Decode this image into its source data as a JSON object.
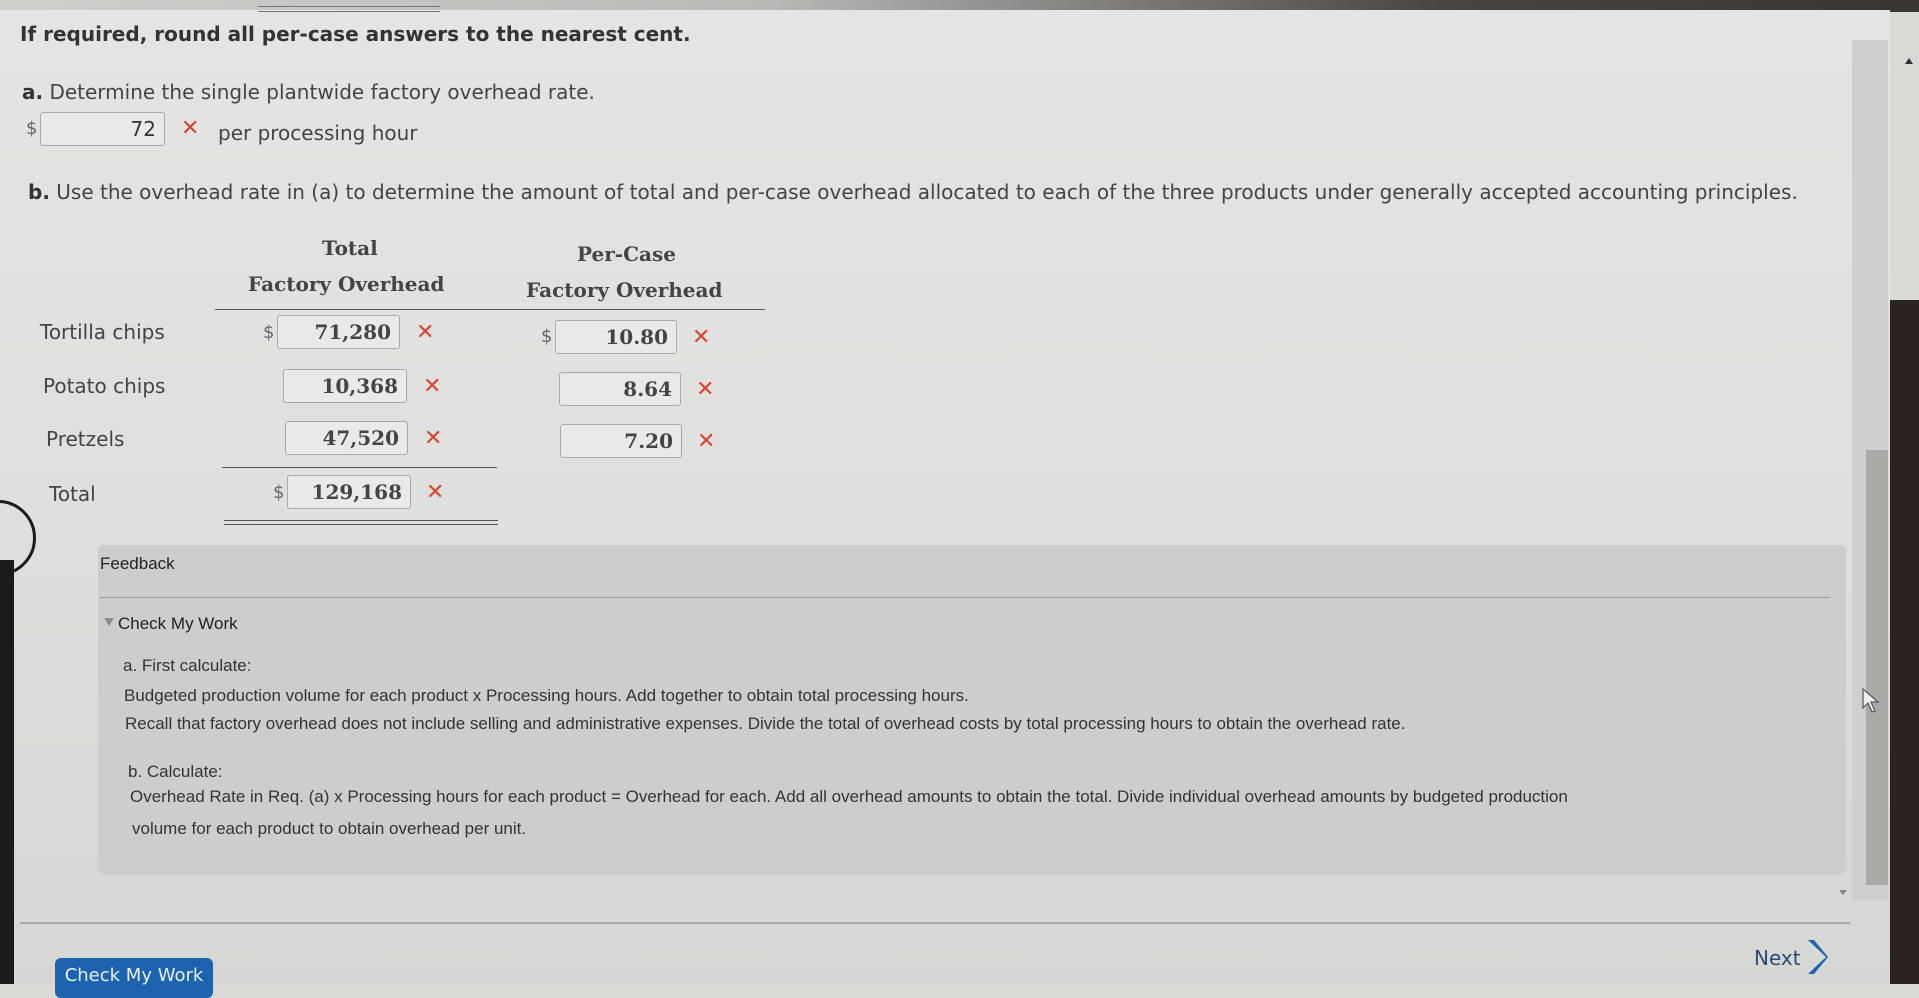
{
  "instruction": "If required, round all per-case answers to the nearest cent.",
  "part_a": {
    "prefix": "a.",
    "question": "Determine the single plantwide factory overhead rate.",
    "currency": "$",
    "rate_value": "72",
    "rate_status": "incorrect",
    "unit_label": "per processing hour"
  },
  "part_b": {
    "prefix": "b.",
    "question": "Use the overhead rate in (a) to determine the amount of total and per-case overhead allocated to each of the three products under generally accepted accounting principles.",
    "columns": {
      "total_line1": "Total",
      "total_line2": "Factory Overhead",
      "percase_line1": "Per-Case",
      "percase_line2": "Factory Overhead"
    },
    "currency": "$",
    "rows": [
      {
        "label": "Tortilla chips",
        "total": "71,280",
        "total_status": "incorrect",
        "per_case": "10.80",
        "per_case_status": "incorrect"
      },
      {
        "label": "Potato chips",
        "total": "10,368",
        "total_status": "incorrect",
        "per_case": "8.64",
        "per_case_status": "incorrect"
      },
      {
        "label": "Pretzels",
        "total": "47,520",
        "total_status": "incorrect",
        "per_case": "7.20",
        "per_case_status": "incorrect"
      },
      {
        "label": "Total",
        "total": "129,168",
        "total_status": "incorrect"
      }
    ]
  },
  "icons": {
    "incorrect": "✕",
    "incorrect_color": "#d9452e"
  },
  "feedback": {
    "title": "Feedback",
    "toggle_label": "Check My Work",
    "a_heading": "a. First calculate:",
    "a_line1": "Budgeted production volume for each product x Processing hours. Add together to obtain total processing hours.",
    "a_line2": "Recall that factory overhead does not include selling and administrative expenses. Divide the total of overhead costs by total processing hours to obtain the overhead rate.",
    "b_heading": "b. Calculate:",
    "b_line1": "Overhead Rate in Req. (a) x Processing hours for each product = Overhead for each. Add all overhead amounts to obtain the total. Divide individual overhead amounts by budgeted production",
    "b_line2": "volume for each product to obtain overhead per unit."
  },
  "footer": {
    "check_button": "Check My Work",
    "next_label": "Next",
    "button_color": "#1e63ad"
  }
}
